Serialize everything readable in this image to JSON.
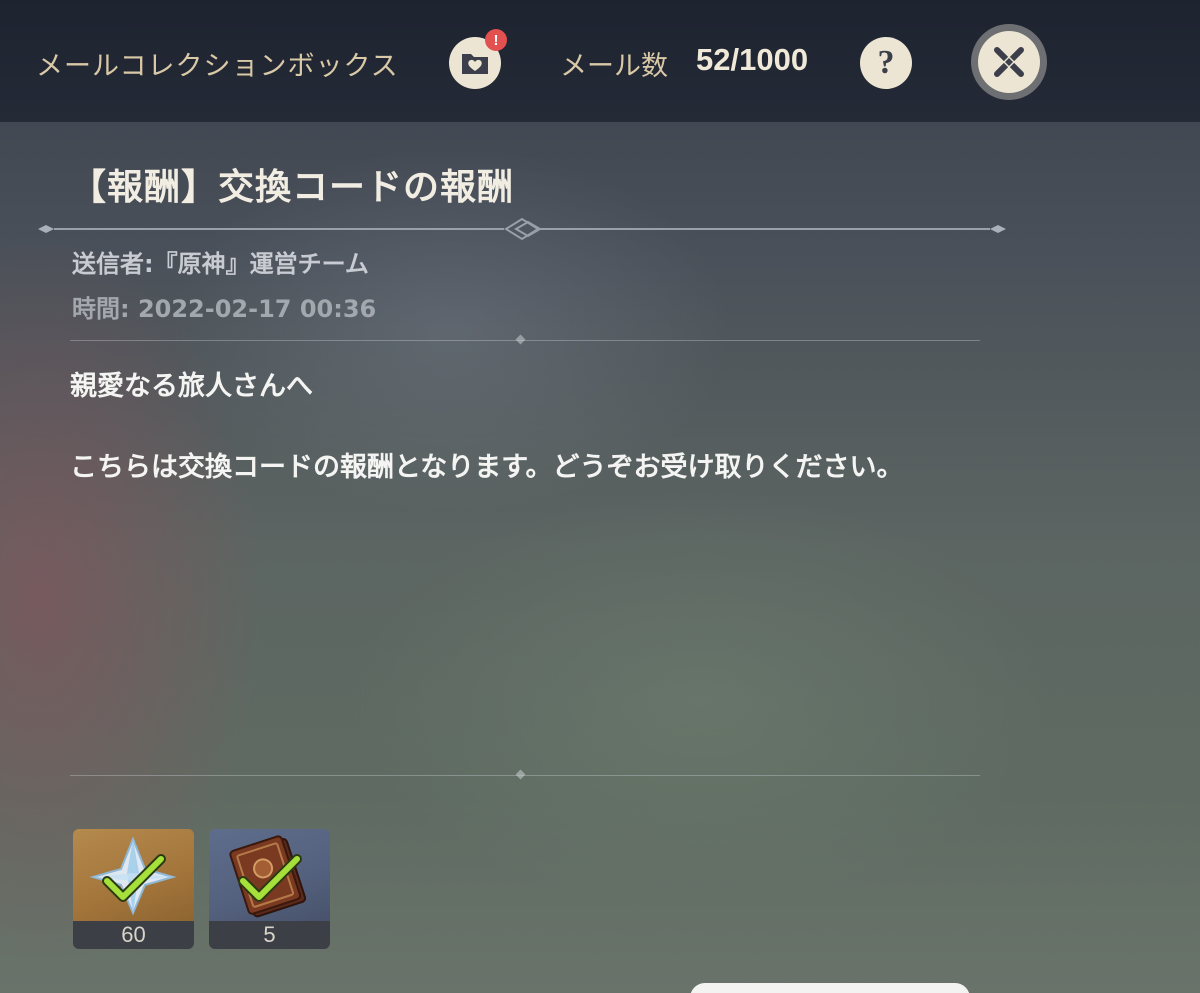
{
  "header": {
    "title": "メールコレクションボックス",
    "collection_badge": "!",
    "mail_count_label": "メール数",
    "mail_count_value": "52/1000",
    "help_label": "?"
  },
  "mail": {
    "title": "【報酬】交換コードの報酬",
    "sender": "送信者:『原神』運営チーム",
    "time": "時間: 2022-02-17 00:36",
    "greeting": "親愛なる旅人さんへ",
    "body": "こちらは交換コードの報酬となります。どうぞお受け取りください。"
  },
  "rewards": [
    {
      "icon": "primogem-icon",
      "count": "60",
      "claimed": true
    },
    {
      "icon": "heros-wit-icon",
      "count": "5",
      "claimed": true
    }
  ],
  "colors": {
    "header_bg": "#1e2330",
    "header_text": "#d9c9a6",
    "button_bg": "#ece5d3",
    "badge": "#e2504f",
    "check": "#a6e03a"
  }
}
